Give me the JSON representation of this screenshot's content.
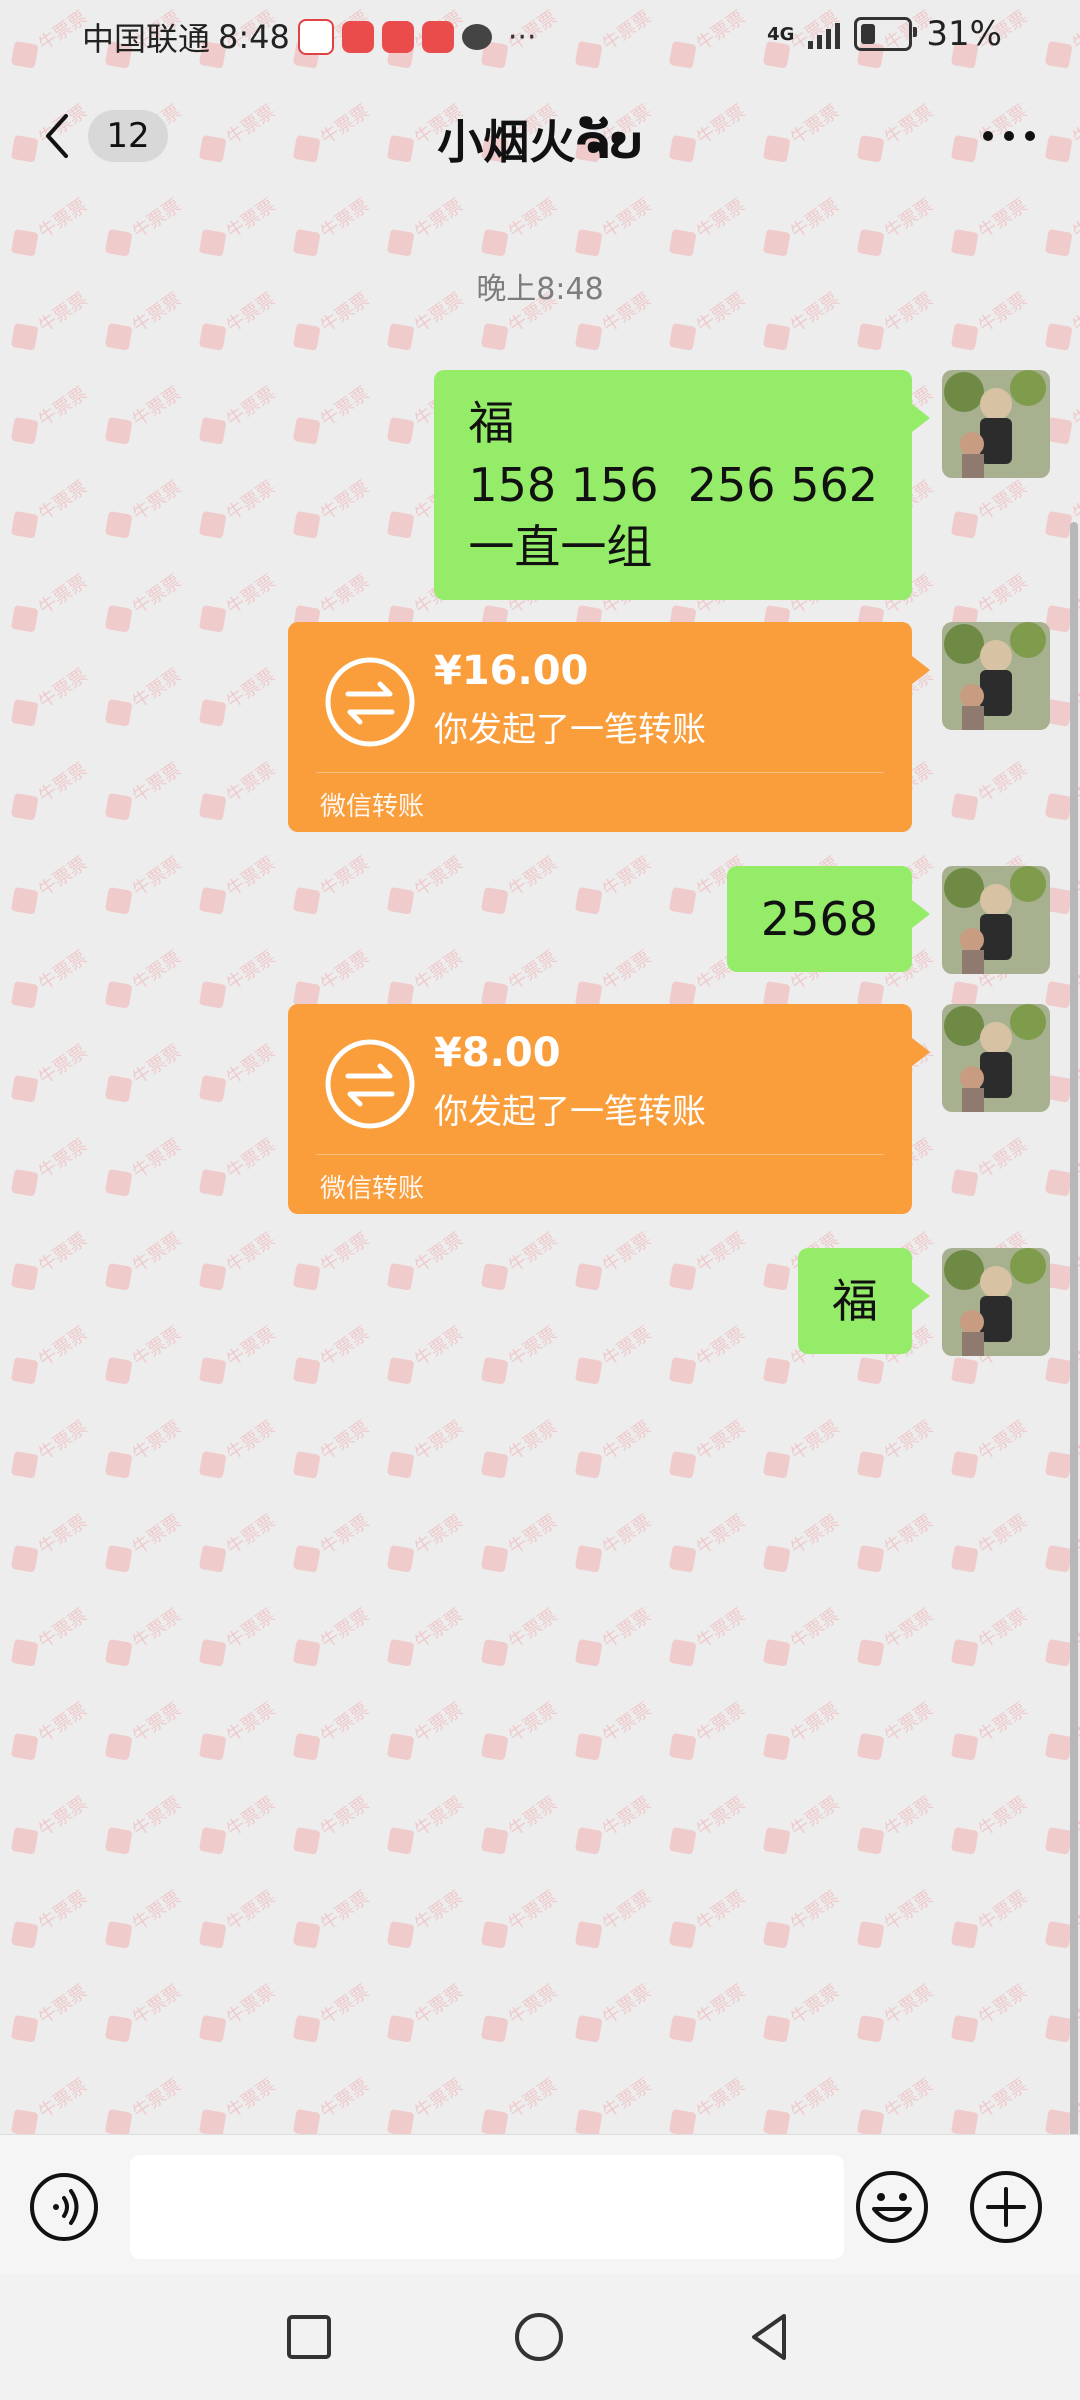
{
  "status_bar": {
    "carrier": "中国联通",
    "time": "8:48",
    "more": "···",
    "network": "4G",
    "battery": "31%",
    "battery_level": 0.31
  },
  "header": {
    "back_badge": "12",
    "title": "小烟火ຈັບ"
  },
  "chat": {
    "timestamp": "晚上8:48",
    "messages": [
      {
        "type": "text",
        "text": "福\n158 156  256 562\n一直一组"
      },
      {
        "type": "transfer",
        "amount": "¥16.00",
        "note": "你发起了一笔转账",
        "source": "微信转账"
      },
      {
        "type": "text",
        "text": "2568"
      },
      {
        "type": "transfer",
        "amount": "¥8.00",
        "note": "你发起了一笔转账",
        "source": "微信转账"
      },
      {
        "type": "text",
        "text": "福"
      }
    ]
  },
  "input_bar": {
    "placeholder": ""
  },
  "watermark": {
    "text": "牛票票"
  },
  "colors": {
    "background": "#ededed",
    "bubble_green": "#95ec69",
    "transfer_orange": "#fa9d3b",
    "watermark_red": "#f0a0a4"
  },
  "icons": {
    "back": "chevron-left-icon",
    "more": "more-dots-icon",
    "voice": "voice-icon",
    "emoji": "emoji-icon",
    "plus": "plus-icon",
    "transfer": "transfer-arrows-icon",
    "nav_recent": "square-icon",
    "nav_home": "circle-icon",
    "nav_back": "triangle-icon"
  }
}
